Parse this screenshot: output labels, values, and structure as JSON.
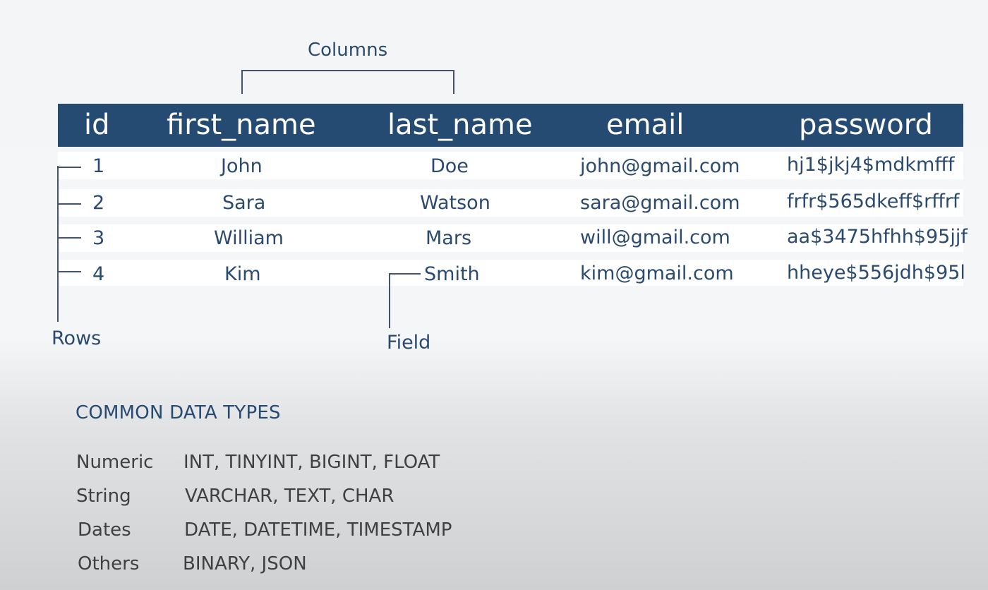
{
  "annotations": {
    "columns": "Columns",
    "rows": "Rows",
    "field": "Field"
  },
  "table": {
    "headers": [
      "id",
      "first_name",
      "last_name",
      "email",
      "password"
    ],
    "rows": [
      [
        "1",
        "John",
        "Doe",
        "john@gmail.com",
        "hj1$jkj4$mdkmfff"
      ],
      [
        "2",
        "Sara",
        "Watson",
        "sara@gmail.com",
        "frfr$565dkeff$rffrf"
      ],
      [
        "3",
        "William",
        "Mars",
        "will@gmail.com",
        "aa$3475hfhh$95jjf"
      ],
      [
        "4",
        "Kim",
        "Smith",
        "kim@gmail.com",
        "hheye$556jdh$95l"
      ]
    ]
  },
  "data_types": {
    "heading": "COMMON DATA TYPES",
    "items": [
      {
        "name": "Numeric",
        "values": "INT, TINYINT, BIGINT, FLOAT"
      },
      {
        "name": "String",
        "values": "VARCHAR, TEXT, CHAR"
      },
      {
        "name": "Dates",
        "values": "DATE, DATETIME, TIMESTAMP"
      },
      {
        "name": "Others",
        "values": "BINARY, JSON"
      }
    ]
  },
  "colors": {
    "header_bg": "#264b73",
    "text_blue": "#2b4a70",
    "text_gray": "#404040"
  }
}
